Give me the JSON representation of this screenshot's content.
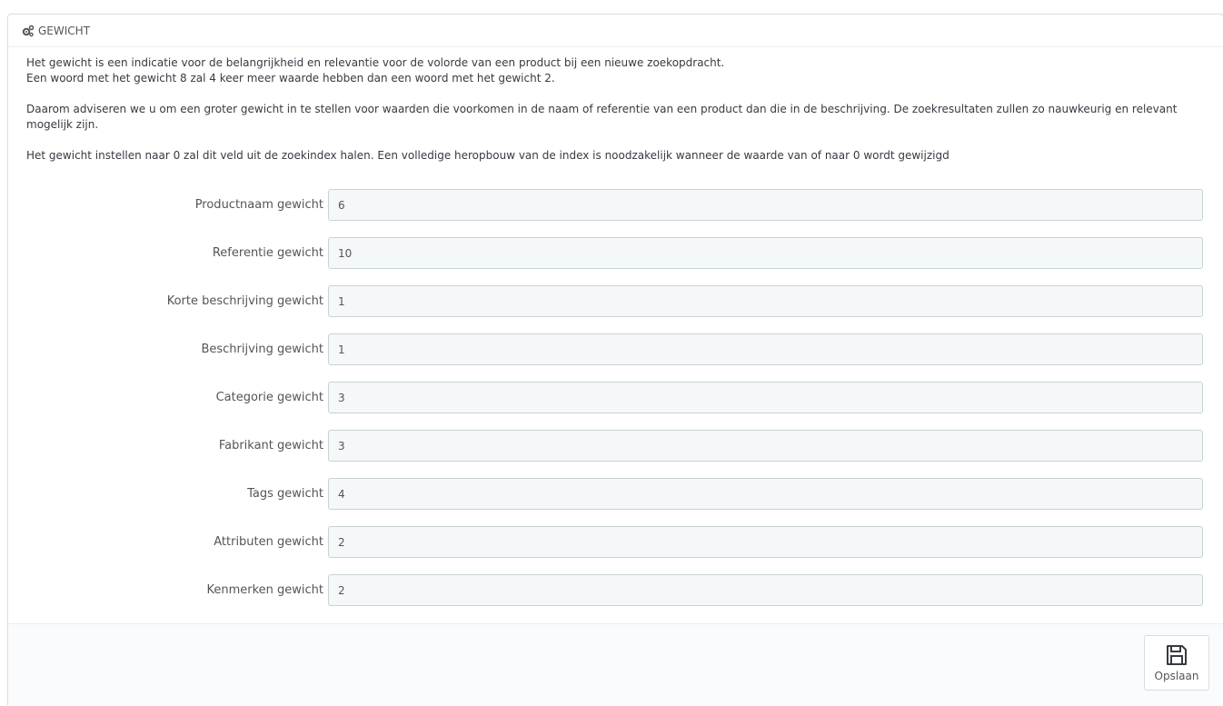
{
  "panel": {
    "title": "Gewicht",
    "icon": "cogs-icon"
  },
  "help": {
    "line1": "Het gewicht is een indicatie voor de belangrijkheid en relevantie voor de volorde van een product bij een nieuwe zoekopdracht.",
    "line2": "Een woord met het gewicht 8 zal 4 keer meer waarde hebben dan een woord met het gewicht 2.",
    "line3": "Daarom adviseren we u om een groter gewicht in te stellen voor waarden die voorkomen in de naam of referentie van een product dan die in de beschrijving. De zoekresultaten zullen zo nauwkeurig en relevant mogelijk zijn.",
    "line4": "Het gewicht instellen naar 0 zal dit veld uit de zoekindex halen. Een volledige heropbouw van de index is noodzakelijk wanneer de waarde van of naar 0 wordt gewijzigd"
  },
  "fields": [
    {
      "label": "Productnaam gewicht",
      "value": "6"
    },
    {
      "label": "Referentie gewicht",
      "value": "10"
    },
    {
      "label": "Korte beschrijving gewicht",
      "value": "1"
    },
    {
      "label": "Beschrijving gewicht",
      "value": "1"
    },
    {
      "label": "Categorie gewicht",
      "value": "3"
    },
    {
      "label": "Fabrikant gewicht",
      "value": "3"
    },
    {
      "label": "Tags gewicht",
      "value": "4"
    },
    {
      "label": "Attributen gewicht",
      "value": "2"
    },
    {
      "label": "Kenmerken gewicht",
      "value": "2"
    }
  ],
  "footer": {
    "save_label": "Opslaan",
    "save_icon": "floppy-disk-icon"
  }
}
